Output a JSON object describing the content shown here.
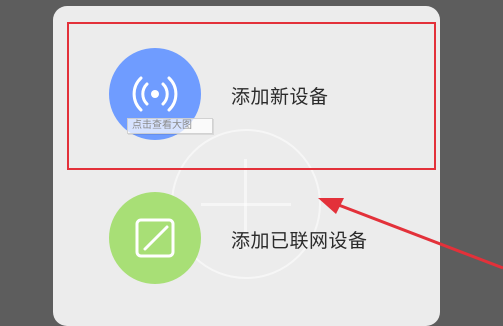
{
  "dialog": {
    "options": [
      {
        "label": "添加新设备",
        "icon": "wireless-signal-icon",
        "icon_color": "#6f9cff"
      },
      {
        "label": "添加已联网设备",
        "icon": "edit-square-icon",
        "icon_color": "#a8df76"
      }
    ]
  },
  "tooltip": {
    "text": "点击查看大图"
  },
  "annotation": {
    "highlight_color": "#e3313a",
    "arrow_color": "#e3313a"
  }
}
